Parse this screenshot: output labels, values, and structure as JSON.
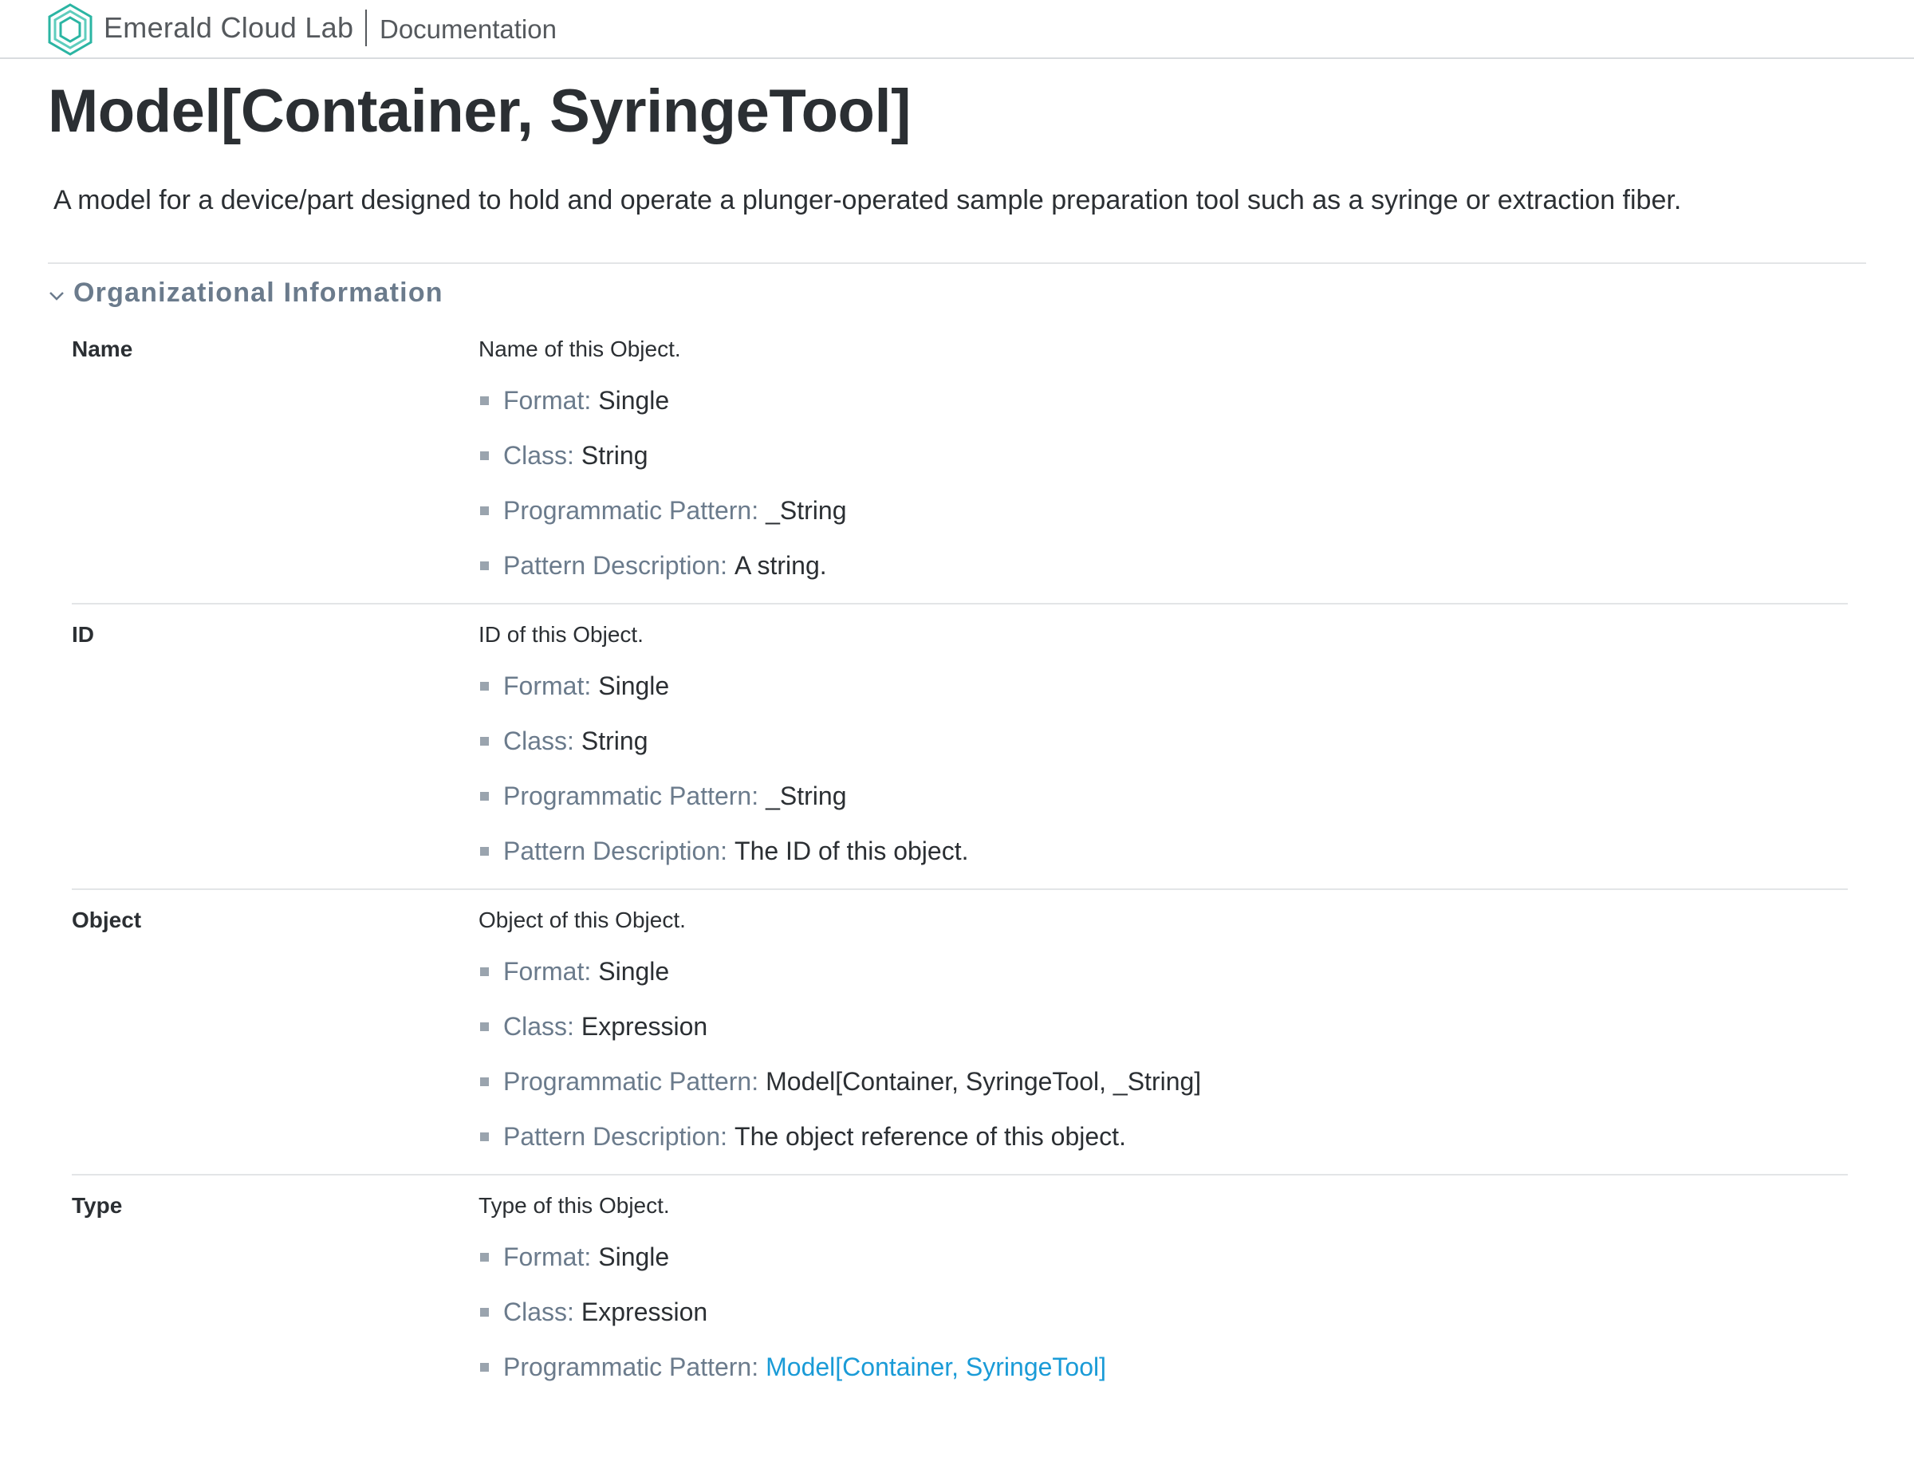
{
  "header": {
    "brand": "Emerald Cloud Lab",
    "section": "Documentation"
  },
  "page": {
    "title": "Model[Container, SyringeTool]",
    "description": "A model for a device/part designed to hold and operate a plunger-operated sample preparation tool such as a syringe or extraction fiber."
  },
  "section": {
    "title": "Organizational Information",
    "expanded": true
  },
  "labels": {
    "format": "Format:",
    "class": "Class:",
    "pattern": "Programmatic Pattern:",
    "pattern_description": "Pattern Description:"
  },
  "fields": [
    {
      "name": "Name",
      "description": "Name of this Object.",
      "format": "Single",
      "class": "String",
      "pattern": "_String",
      "pattern_description": "A string."
    },
    {
      "name": "ID",
      "description": "ID of this Object.",
      "format": "Single",
      "class": "String",
      "pattern": "_String",
      "pattern_description": "The ID of this object."
    },
    {
      "name": "Object",
      "description": "Object of this Object.",
      "format": "Single",
      "class": "Expression",
      "pattern": "Model[Container, SyringeTool, _String]",
      "pattern_description": "The object reference of this object."
    },
    {
      "name": "Type",
      "description": "Type of this Object.",
      "format": "Single",
      "class": "Expression",
      "pattern": "Model[Container, SyringeTool]"
    }
  ],
  "colors": {
    "accent": "#2bb5a3",
    "label": "#6b7b8c",
    "link": "#1a9bd7",
    "text": "#2b2f33",
    "rule": "#e3e5e7"
  }
}
